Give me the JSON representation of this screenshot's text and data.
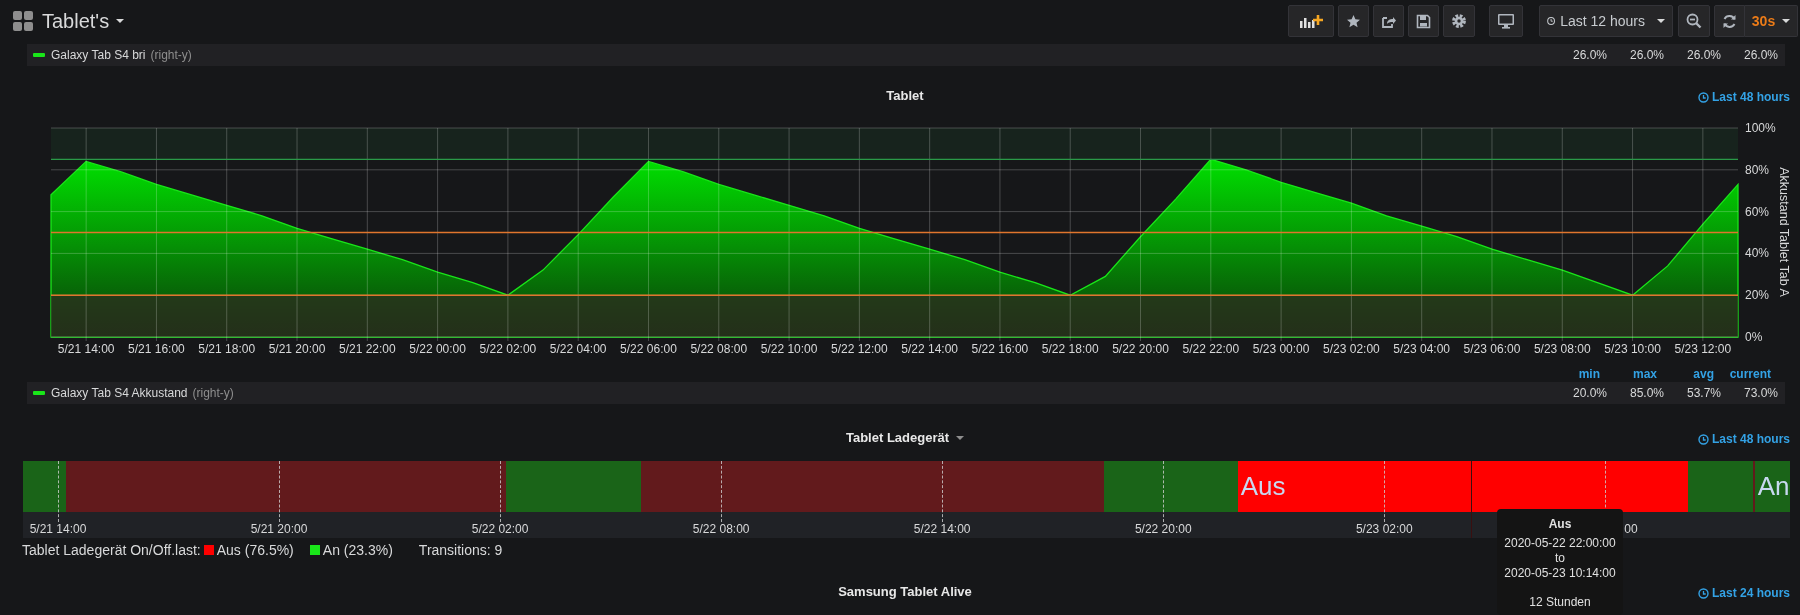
{
  "dashboard": {
    "title": "Tablet's"
  },
  "toolbar": [
    {
      "kind": "add-panel"
    },
    {
      "kind": "star"
    },
    {
      "kind": "share"
    },
    {
      "kind": "save"
    },
    {
      "kind": "settings"
    },
    {
      "kind": "tv"
    }
  ],
  "time_picker": {
    "label": "Last 12 hours"
  },
  "zoom_out": {
    "kind": "zoom-out"
  },
  "refresh": {
    "interval": "30s"
  },
  "top_legend": {
    "rows": [
      {
        "name": "Galaxy Tab S4 bri",
        "axis": "(right-y)",
        "color": "#19e619",
        "values": [
          "26.0%",
          "26.0%",
          "26.0%",
          "26.0%"
        ]
      }
    ]
  },
  "tablet_panel": {
    "title": "Tablet",
    "time_override": "Last 48 hours",
    "chart_data": {
      "type": "area",
      "ylabel": "Akkustand Tablet Tab A",
      "ylim": [
        0,
        100
      ],
      "categories": [
        null,
        "5/21 14:00",
        null,
        "5/21 16:00",
        null,
        "5/21 18:00",
        null,
        "5/21 20:00",
        null,
        "5/21 22:00",
        null,
        "5/22 00:00",
        null,
        "5/22 02:00",
        null,
        "5/22 04:00",
        null,
        "5/22 06:00",
        null,
        "5/22 08:00",
        null,
        "5/22 10:00",
        null,
        "5/22 12:00",
        null,
        "5/22 14:00",
        null,
        "5/22 16:00",
        null,
        "5/22 18:00",
        null,
        "5/22 20:00",
        null,
        "5/22 22:00",
        null,
        "5/23 00:00",
        null,
        "5/23 02:00",
        null,
        "5/23 04:00",
        null,
        "5/23 06:00",
        null,
        "5/23 08:00",
        null,
        "5/23 10:00",
        null,
        "5/23 12:00",
        null
      ],
      "series": [
        {
          "name": "Galaxy Tab S4 Akkustand",
          "color": "#19e619",
          "values": [
            68,
            84,
            79,
            73,
            68,
            63,
            58,
            52,
            47,
            42,
            37,
            31,
            26,
            20,
            32,
            49,
            67,
            84,
            79,
            73,
            68,
            63,
            58,
            52,
            47,
            42,
            37,
            31,
            26,
            20,
            29,
            48,
            66,
            85,
            80,
            74,
            69,
            64,
            58,
            53,
            48,
            42,
            37,
            32,
            26,
            20,
            34,
            54,
            73
          ]
        }
      ],
      "yticks": [
        {
          "value": 0,
          "label": "0%"
        },
        {
          "value": 20,
          "label": "20%"
        },
        {
          "value": 40,
          "label": "40%"
        },
        {
          "value": 60,
          "label": "60%"
        },
        {
          "value": 80,
          "label": "80%"
        },
        {
          "value": 100,
          "label": "100%"
        }
      ],
      "grid": true,
      "ref_lines": [
        {
          "axis": "y",
          "value": 85,
          "color": "#2a9a48"
        },
        {
          "axis": "y",
          "value": 50,
          "color": "#e0752d"
        },
        {
          "axis": "y",
          "value": 20,
          "color": "#e0752d"
        }
      ],
      "bands": [
        {
          "axis": "y",
          "from": 85,
          "to": 100,
          "color": "#18291f"
        },
        {
          "axis": "y",
          "from": 0,
          "to": 20,
          "color": "#2f2a21"
        }
      ]
    },
    "legend": {
      "columns": [
        "min",
        "max",
        "avg",
        "current"
      ],
      "rows": [
        {
          "axis": "(right-y)",
          "values": [
            "20.0%",
            "85.0%",
            "53.7%",
            "73.0%"
          ]
        }
      ]
    }
  },
  "charger_panel": {
    "title": "Tablet Ladegerät",
    "time_override": "Last 48 hours",
    "segments": [
      {
        "color": "#1a6418"
      },
      {
        "color": "#621a1c"
      },
      {
        "color": "#1a6418"
      },
      {
        "color": "#621a1c"
      },
      {
        "color": "#1a6418"
      },
      {
        "color": "#ff0000",
        "label": "Aus"
      },
      {
        "color": "#1a6418"
      },
      {
        "color": "#621a1c"
      },
      {
        "color": "#1a6418",
        "label": "An"
      }
    ],
    "axis_labels": [
      "5/21 14:00",
      "5/21 20:00",
      "5/22 02:00",
      "5/22 08:00",
      "5/22 14:00",
      "5/22 20:00",
      "5/23 02:00",
      "00"
    ],
    "legend": {
      "title": "Tablet Ladegerät On/Off.last:",
      "items": [
        {
          "label": "Aus (76.5%)",
          "color": "#ff0000"
        },
        {
          "label": "An (23.3%)",
          "color": "#19e619"
        }
      ],
      "transitions": "Transitions: 9"
    },
    "tooltip": {
      "title": "Aus",
      "from": "2020-05-22 22:00:00",
      "separator": "to",
      "to": "2020-05-23 10:14:00",
      "duration": "12 Stunden"
    }
  },
  "alive_panel": {
    "title": "Samsung Tablet Alive",
    "time_override": "Last 24 hours"
  }
}
